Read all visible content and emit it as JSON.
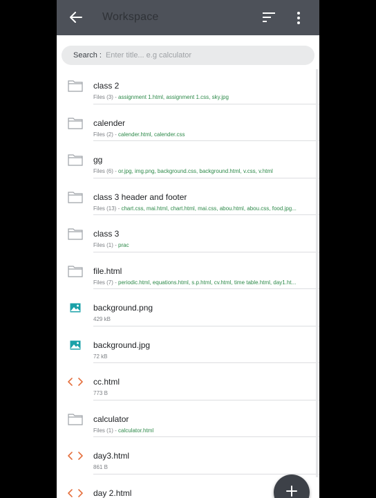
{
  "app_bar": {
    "title": "Workspace",
    "back_icon": "arrow-back-icon",
    "sort_icon": "sort-icon",
    "more_icon": "more-vert-icon"
  },
  "search": {
    "label": "Search :",
    "placeholder": "Enter title... e.g calculator"
  },
  "items": [
    {
      "type": "folder",
      "name": "class 2",
      "files": "Files (3)",
      "detail": "assignment 1.html, assignment 1.css, sky.jpg"
    },
    {
      "type": "folder",
      "name": "calender",
      "files": "Files (2)",
      "detail": "calender.html, calender.css"
    },
    {
      "type": "folder",
      "name": "gg",
      "files": "Files (6)",
      "detail": "or.jpg, img.png, background.css, background.html, v.css, v.html"
    },
    {
      "type": "folder",
      "name": "class 3 header and footer",
      "files": "Files (13)",
      "detail": "chart.css, mai.html, chart.html, mai.css, abou.html, abou.css, food.jpg..."
    },
    {
      "type": "folder",
      "name": "class 3",
      "files": "Files (1)",
      "detail": "prac"
    },
    {
      "type": "folder",
      "name": "file.html",
      "files": "Files (7)",
      "detail": "periodic.html, equations.html, s.p.html, cv.html, time table.html, day1.ht..."
    },
    {
      "type": "image",
      "name": "background.png",
      "size": "429 kB"
    },
    {
      "type": "image",
      "name": "background.jpg",
      "size": "72 kB"
    },
    {
      "type": "code",
      "name": "cc.html",
      "size": "773 B"
    },
    {
      "type": "folder",
      "name": "calculator",
      "files": "Files (1)",
      "detail": "calculator.html"
    },
    {
      "type": "code",
      "name": "day3.html",
      "size": "861 B"
    },
    {
      "type": "code",
      "name": "day 2.html",
      "size": ""
    }
  ],
  "colors": {
    "app_bar": "#4d5159",
    "folder_icon": "#9ea2a8",
    "image_icon": "#1aa1a8",
    "code_icon": "#e5713f",
    "file_names": "#2e8a4a",
    "fab": "#3d4148"
  },
  "fab": {
    "icon": "add-icon"
  }
}
